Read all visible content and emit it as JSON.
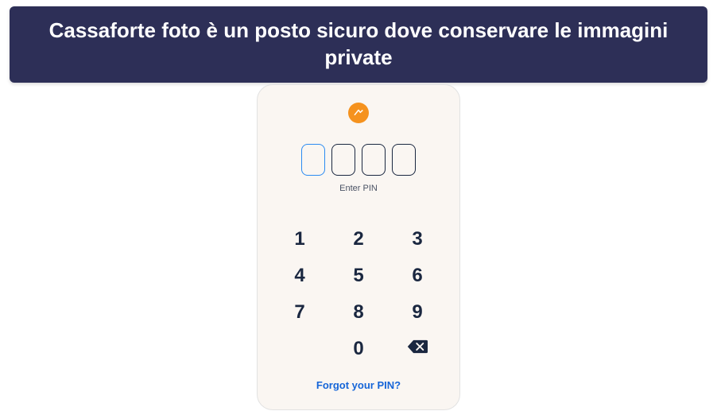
{
  "banner": {
    "text": "Cassaforte foto è un posto sicuro dove conservare le immagini private"
  },
  "pin": {
    "label": "Enter PIN",
    "length": 4,
    "active_index": 0
  },
  "keypad": {
    "k1": "1",
    "k2": "2",
    "k3": "3",
    "k4": "4",
    "k5": "5",
    "k6": "6",
    "k7": "7",
    "k8": "8",
    "k9": "9",
    "k0": "0"
  },
  "forgot": {
    "label": "Forgot your PIN?"
  },
  "colors": {
    "banner_bg": "#2d2f57",
    "accent_orange": "#f5921e",
    "link_blue": "#1565d8",
    "active_box": "#2b8bf2"
  }
}
